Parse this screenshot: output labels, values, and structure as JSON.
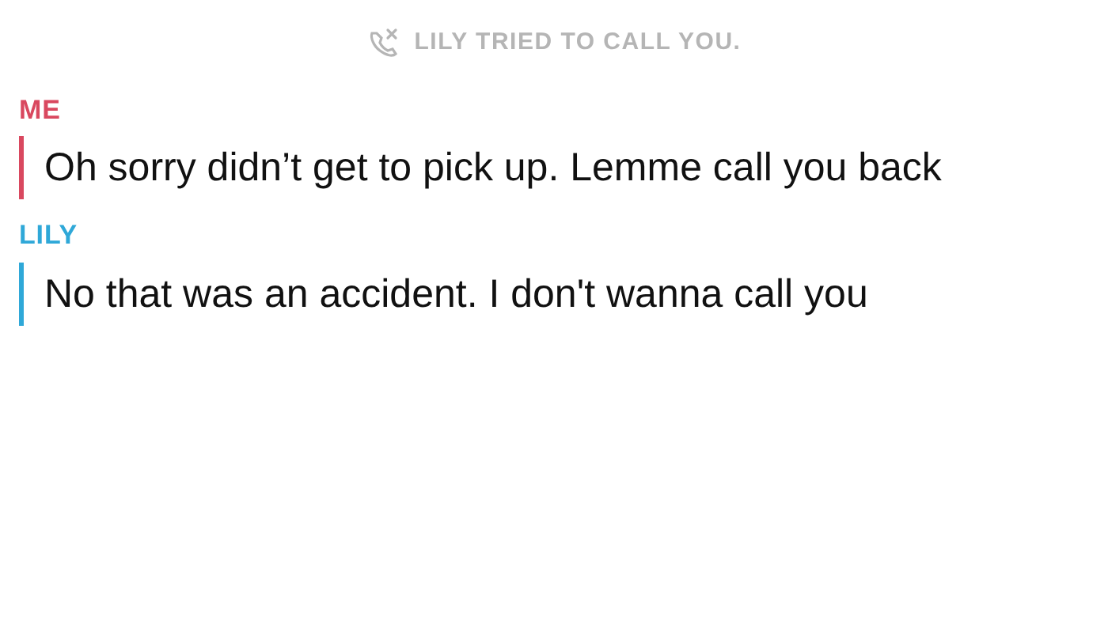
{
  "notice": {
    "text": "LILY TRIED TO CALL YOU."
  },
  "messages": [
    {
      "sender": "ME",
      "color": "#d9485f",
      "text": "Oh sorry didn’t get to pick up. Lemme call you back"
    },
    {
      "sender": "LILY",
      "color": "#2fa8d8",
      "text": "No that was an accident. I don't wanna call you"
    }
  ]
}
